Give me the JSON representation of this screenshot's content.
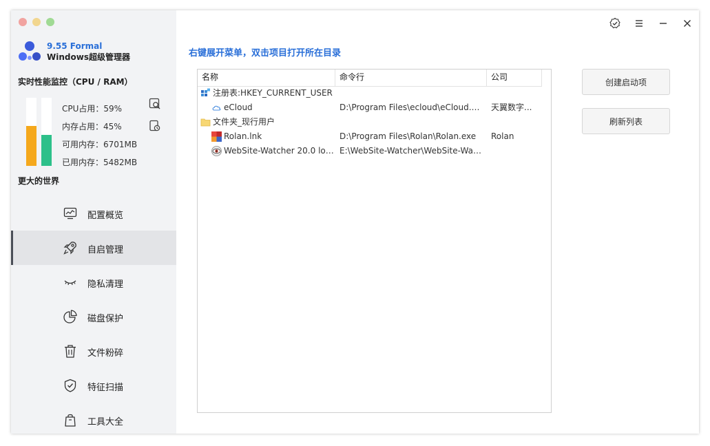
{
  "brand": {
    "version": "9.55 Formal",
    "name": "Windows超级管理器"
  },
  "perf": {
    "title": "实时性能监控（CPU / RAM）",
    "cpu_percent": 59,
    "mem_percent": 45,
    "cpu_color": "#f5a81c",
    "mem_color": "#2dc08a",
    "stats": [
      "CPU占用：59%",
      "内存占用：45%",
      "可用内存：6701MB",
      "已用内存：5482MB"
    ]
  },
  "slogan": "更大的世界",
  "nav": [
    {
      "label": "配置概览",
      "icon": "chart-monitor-icon"
    },
    {
      "label": "自启管理",
      "icon": "rocket-icon",
      "active": true
    },
    {
      "label": "隐私清理",
      "icon": "closed-eye-icon"
    },
    {
      "label": "磁盘保护",
      "icon": "pie-chart-icon"
    },
    {
      "label": "文件粉碎",
      "icon": "trash-icon"
    },
    {
      "label": "特征扫描",
      "icon": "shield-check-icon"
    },
    {
      "label": "工具大全",
      "icon": "bag-icon"
    }
  ],
  "hint": "右键展开菜单，双击项目打开所在目录",
  "table": {
    "columns": [
      "名称",
      "命令行",
      "公司"
    ],
    "rows": [
      {
        "name": "注册表:HKEY_CURRENT_USER",
        "command": "",
        "company": "",
        "icon": "registry-icon",
        "group": true
      },
      {
        "name": "eCloud",
        "command": "D:\\Program Files\\ecloud\\eCloud.e...",
        "company": "天翼数字...",
        "icon": "cloud-icon",
        "group": false
      },
      {
        "name": "文件夹_现行用户",
        "command": "",
        "company": "",
        "icon": "folder-icon",
        "group": true
      },
      {
        "name": "Rolan.lnk",
        "command": "D:\\Program Files\\Rolan\\Rolan.exe",
        "company": "Rolan",
        "icon": "rolan-app-icon",
        "group": false
      },
      {
        "name": "WebSite-Watcher 20.0 loa...",
        "command": "E:\\WebSite-Watcher\\WebSite-Wat...",
        "company": "",
        "icon": "eye-app-icon",
        "group": false
      }
    ]
  },
  "buttons": {
    "create": "创建启动项",
    "refresh": "刷新列表"
  }
}
